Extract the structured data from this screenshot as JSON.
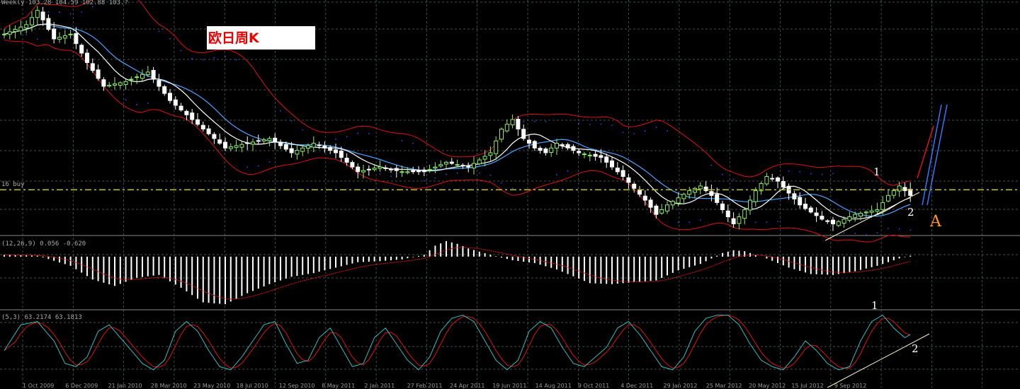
{
  "title_box": {
    "text": "欧日周K"
  },
  "header": {
    "main": "Weekly 103.28 104.59 102.88 103.?",
    "macd": "(12,26,9) 0.056 -0.620",
    "stoch": "(5,3) 63.2174 63.1813",
    "hline": "16 buy"
  },
  "annotations": {
    "main_1": "1",
    "main_2": "2",
    "main_A": "A",
    "stoch_1": "1",
    "stoch_2": "2"
  },
  "colors": {
    "background": "#000000",
    "grid": "#5a6a6a",
    "bull": "#88ee66",
    "bear": "#ffffff",
    "bollinger": "#dd1111",
    "ma_white": "#ffffff",
    "ma_blue": "#4aa3ff",
    "sar": "#3344ff",
    "hline": "#b8b830",
    "macd_hist": "#ffffff",
    "macd_signal": "#dd1111",
    "stoch_k": "#33bbbb",
    "stoch_d": "#dd1111",
    "annotation": "#ffffff",
    "label_A": "#ff9922",
    "projection_red": "#dd1111",
    "projection_blue": "#3377ff",
    "trendline": "#f0f0c0"
  },
  "x_axis_dates": [
    "1 Oct 2009",
    "6 Dec 2009",
    "21 Jan 2010",
    "28 Mar 2010",
    "23 May 2010",
    "18 Jul 2010",
    "12 Sep 2010",
    "8 May 2011",
    "2 Jan 2011",
    "27 Feb 2011",
    "24 Apr 2011",
    "19 Jun 2011",
    "14 Aug 2011",
    "9 Oct 2011",
    "4 Dec 2011",
    "29 Jan 2012",
    "25 Mar 2012",
    "20 May 2012",
    "15 Jul 2012",
    "9 Sep 2012"
  ],
  "chart_data": [
    {
      "type": "candlestick",
      "title": "欧日周K",
      "price_keypoints": [
        [
          0,
          135
        ],
        [
          4,
          137
        ],
        [
          6,
          140
        ],
        [
          9,
          134
        ],
        [
          12,
          135
        ],
        [
          15,
          129
        ],
        [
          18,
          124
        ],
        [
          22,
          125
        ],
        [
          26,
          127
        ],
        [
          30,
          121
        ],
        [
          34,
          117
        ],
        [
          38,
          113
        ],
        [
          40,
          111
        ],
        [
          44,
          112
        ],
        [
          48,
          113
        ],
        [
          52,
          110
        ],
        [
          56,
          112
        ],
        [
          60,
          110
        ],
        [
          62,
          108
        ],
        [
          64,
          106
        ],
        [
          68,
          107
        ],
        [
          72,
          106
        ],
        [
          76,
          106
        ],
        [
          80,
          108
        ],
        [
          84,
          107
        ],
        [
          88,
          110
        ],
        [
          90,
          115
        ],
        [
          92,
          117
        ],
        [
          94,
          113
        ],
        [
          96,
          111
        ],
        [
          98,
          110
        ],
        [
          100,
          112
        ],
        [
          104,
          110
        ],
        [
          108,
          109
        ],
        [
          112,
          105
        ],
        [
          116,
          100
        ],
        [
          118,
          97
        ],
        [
          120,
          99
        ],
        [
          124,
          102
        ],
        [
          126,
          103
        ],
        [
          128,
          101
        ],
        [
          130,
          98
        ],
        [
          132,
          95
        ],
        [
          134,
          98
        ],
        [
          136,
          102
        ],
        [
          138,
          105
        ],
        [
          140,
          104
        ],
        [
          144,
          99
        ],
        [
          148,
          96
        ],
        [
          150,
          95
        ],
        [
          154,
          97
        ],
        [
          158,
          98
        ],
        [
          160,
          101
        ],
        [
          162,
          103
        ],
        [
          164,
          101
        ]
      ],
      "horizontal_line": 102.2,
      "bollinger": "20-period bands",
      "series": [
        {
          "name": "Bollinger upper"
        },
        {
          "name": "Bollinger lower"
        },
        {
          "name": "MA fast"
        },
        {
          "name": "MA slow"
        },
        {
          "name": "Parabolic SAR"
        }
      ]
    },
    {
      "type": "bar",
      "title": "MACD(12,26,9)",
      "values_keypoints": [
        [
          0,
          0.2
        ],
        [
          6,
          0.1
        ],
        [
          12,
          -1.0
        ],
        [
          16,
          -2.5
        ],
        [
          20,
          -3.2
        ],
        [
          24,
          -2.3
        ],
        [
          28,
          -2.0
        ],
        [
          32,
          -3.4
        ],
        [
          36,
          -5.0
        ],
        [
          40,
          -5.2
        ],
        [
          44,
          -4.0
        ],
        [
          48,
          -3.0
        ],
        [
          52,
          -2.2
        ],
        [
          56,
          -1.8
        ],
        [
          60,
          -1.2
        ],
        [
          64,
          -0.6
        ],
        [
          68,
          -0.5
        ],
        [
          72,
          -0.3
        ],
        [
          76,
          0.2
        ],
        [
          78,
          1.2
        ],
        [
          80,
          1.7
        ],
        [
          82,
          1.4
        ],
        [
          84,
          0.9
        ],
        [
          88,
          0.2
        ],
        [
          92,
          -0.4
        ],
        [
          96,
          -0.7
        ],
        [
          100,
          -1.4
        ],
        [
          104,
          -2.4
        ],
        [
          106,
          -2.9
        ],
        [
          110,
          -3.0
        ],
        [
          114,
          -2.8
        ],
        [
          118,
          -2.6
        ],
        [
          122,
          -1.5
        ],
        [
          126,
          -0.8
        ],
        [
          130,
          0.4
        ],
        [
          132,
          0.7
        ],
        [
          134,
          0.6
        ],
        [
          138,
          -0.2
        ],
        [
          142,
          -1.2
        ],
        [
          146,
          -1.9
        ],
        [
          150,
          -2.0
        ],
        [
          154,
          -1.6
        ],
        [
          158,
          -1.0
        ],
        [
          162,
          -0.2
        ],
        [
          164,
          0.1
        ]
      ],
      "signal": "9-period EMA of MACD",
      "ylim": [
        -5.5,
        2.0
      ]
    },
    {
      "type": "line",
      "title": "Stochastic(5,3)",
      "series": [
        {
          "name": "%K"
        },
        {
          "name": "%D"
        }
      ],
      "k_keypoints": [
        [
          0,
          40
        ],
        [
          3,
          80
        ],
        [
          6,
          85
        ],
        [
          9,
          55
        ],
        [
          11,
          20
        ],
        [
          13,
          15
        ],
        [
          15,
          30
        ],
        [
          17,
          70
        ],
        [
          19,
          80
        ],
        [
          21,
          60
        ],
        [
          23,
          40
        ],
        [
          25,
          20
        ],
        [
          27,
          10
        ],
        [
          29,
          25
        ],
        [
          31,
          70
        ],
        [
          33,
          85
        ],
        [
          35,
          70
        ],
        [
          37,
          40
        ],
        [
          39,
          15
        ],
        [
          41,
          10
        ],
        [
          43,
          30
        ],
        [
          45,
          55
        ],
        [
          47,
          80
        ],
        [
          49,
          85
        ],
        [
          51,
          50
        ],
        [
          53,
          20
        ],
        [
          55,
          25
        ],
        [
          57,
          60
        ],
        [
          59,
          75
        ],
        [
          61,
          45
        ],
        [
          63,
          15
        ],
        [
          65,
          20
        ],
        [
          67,
          60
        ],
        [
          69,
          75
        ],
        [
          71,
          50
        ],
        [
          73,
          25
        ],
        [
          75,
          10
        ],
        [
          77,
          30
        ],
        [
          79,
          70
        ],
        [
          81,
          90
        ],
        [
          83,
          95
        ],
        [
          85,
          85
        ],
        [
          87,
          55
        ],
        [
          89,
          25
        ],
        [
          91,
          10
        ],
        [
          93,
          25
        ],
        [
          95,
          70
        ],
        [
          97,
          85
        ],
        [
          99,
          75
        ],
        [
          101,
          45
        ],
        [
          103,
          20
        ],
        [
          105,
          15
        ],
        [
          107,
          30
        ],
        [
          109,
          45
        ],
        [
          111,
          75
        ],
        [
          113,
          85
        ],
        [
          115,
          65
        ],
        [
          117,
          40
        ],
        [
          119,
          15
        ],
        [
          121,
          10
        ],
        [
          123,
          30
        ],
        [
          125,
          70
        ],
        [
          127,
          90
        ],
        [
          129,
          95
        ],
        [
          131,
          95
        ],
        [
          133,
          80
        ],
        [
          135,
          50
        ],
        [
          137,
          25
        ],
        [
          139,
          15
        ],
        [
          141,
          10
        ],
        [
          143,
          30
        ],
        [
          145,
          55
        ],
        [
          147,
          40
        ],
        [
          149,
          20
        ],
        [
          151,
          10
        ],
        [
          153,
          15
        ],
        [
          155,
          55
        ],
        [
          157,
          85
        ],
        [
          159,
          95
        ],
        [
          161,
          75
        ],
        [
          163,
          60
        ],
        [
          164,
          65
        ]
      ],
      "ylim": [
        0,
        100
      ]
    }
  ]
}
